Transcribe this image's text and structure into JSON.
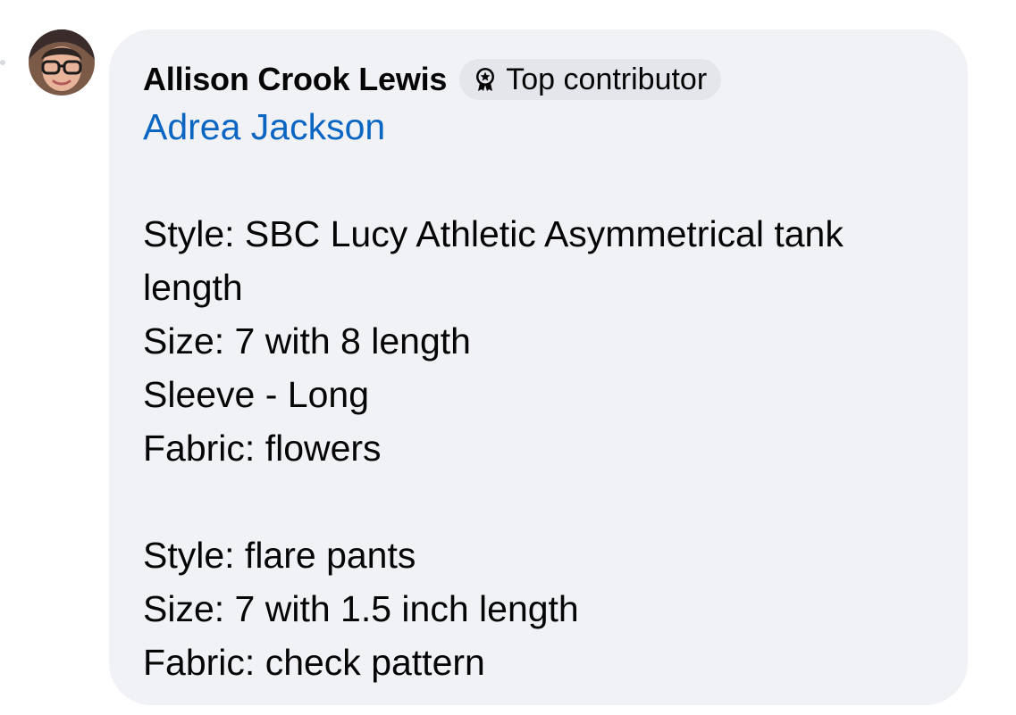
{
  "comment": {
    "author": "Allison Crook Lewis",
    "badge": {
      "icon": "top-contributor-badge-icon",
      "label": "Top contributor"
    },
    "mention": "Adrea Jackson",
    "lines": [
      "",
      "Style: SBC Lucy Athletic Asymmetrical tank",
      "length",
      "Size: 7 with 8 length",
      "Sleeve - Long",
      "Fabric: flowers",
      "",
      "Style: flare pants",
      "Size: 7 with 1.5 inch length",
      "Fabric: check pattern"
    ]
  },
  "colors": {
    "bubble_background": "#f0f2f5",
    "badge_background": "#e4e6eb",
    "mention_link": "#0a66c2",
    "text": "#050505"
  }
}
